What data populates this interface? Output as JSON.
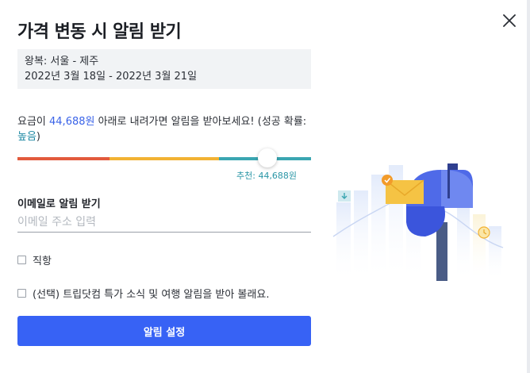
{
  "dialog": {
    "title": "가격 변동 시 알림 받기",
    "close_icon": "close-icon"
  },
  "trip": {
    "route": "왕복: 서울 - 제주",
    "dates": "2022년 3월 18일 - 2022년 3월 21일"
  },
  "message": {
    "prefix": "요금이 ",
    "price": "44,688원",
    "middle": " 아래로 내려가면 알림을 받아보세요! (성공 확률: ",
    "level": "높음",
    "suffix": ")"
  },
  "slider": {
    "recommend_text": "추천: 44,688원",
    "position_fraction": 0.85,
    "colors": [
      "#e25a3c",
      "#f2b233",
      "#3aa6b1"
    ]
  },
  "email": {
    "label": "이메일로 알림 받기",
    "placeholder": "이메일 주소 입력",
    "value": ""
  },
  "options": [
    {
      "label": "직항",
      "checked": false
    },
    {
      "label": "(선택) 트립닷컴 특가 소식 및 여행 알림을 받아 볼래요.",
      "checked": false
    }
  ],
  "submit": {
    "label": "알림 설정"
  },
  "colors": {
    "primary": "#3762f5",
    "price_text": "#3a63e8",
    "level_text": "#1e89a3",
    "recommend_text": "#2a96a6"
  },
  "illustration": {
    "icon": "mailbox-illustration"
  }
}
